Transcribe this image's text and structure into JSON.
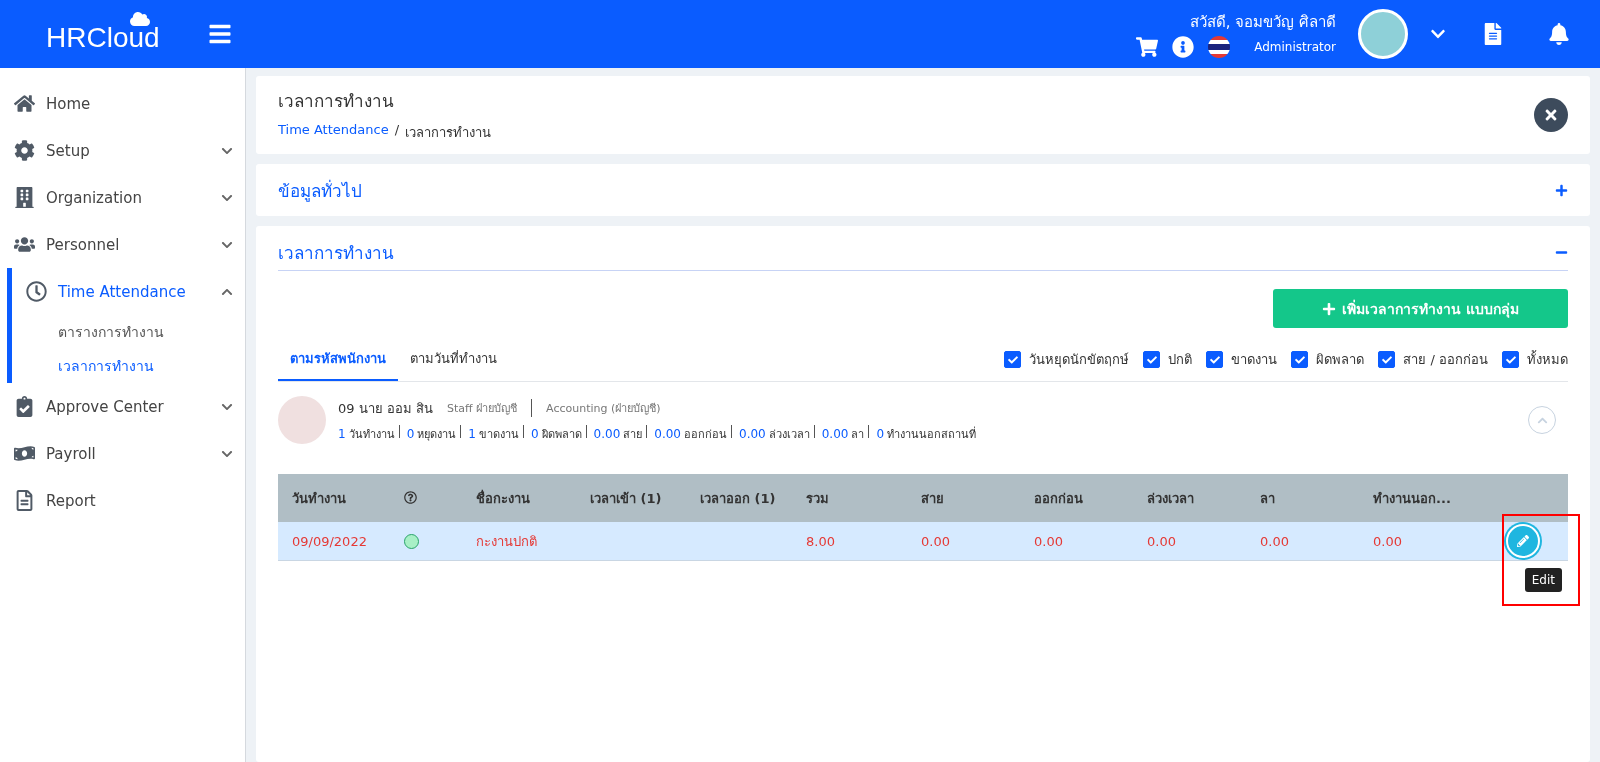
{
  "header": {
    "logo": "HRCloud",
    "greeting": "สวัสดี, จอมขวัญ ศิลาดี",
    "role": "Administrator"
  },
  "sidebar": {
    "items": [
      {
        "label": "Home",
        "kind": "link",
        "selected": false
      },
      {
        "label": "Setup",
        "kind": "menu",
        "selected": false,
        "expanded": false
      },
      {
        "label": "Organization",
        "kind": "menu",
        "selected": false,
        "expanded": false
      },
      {
        "label": "Personnel",
        "kind": "menu",
        "selected": false,
        "expanded": false
      },
      {
        "label": "Time Attendance",
        "kind": "menu",
        "selected": true,
        "expanded": true,
        "children": [
          {
            "label": "ตารางการทำงาน",
            "selected": false
          },
          {
            "label": "เวลาการทำงาน",
            "selected": true
          }
        ]
      },
      {
        "label": "Approve Center",
        "kind": "menu",
        "selected": false,
        "expanded": false
      },
      {
        "label": "Payroll",
        "kind": "menu",
        "selected": false,
        "expanded": false
      },
      {
        "label": "Report",
        "kind": "link",
        "selected": false
      }
    ]
  },
  "page": {
    "title": "เวลาการทำงาน",
    "breadcrumb": [
      {
        "label": "Time Attendance"
      },
      {
        "label": "เวลาการทำงาน"
      }
    ],
    "separator": "/"
  },
  "sections": [
    {
      "title": "ข้อมูลทั่วไป",
      "expanded": false
    },
    {
      "title": "เวลาการทำงาน",
      "expanded": true
    }
  ],
  "add_button": "เพิ่มเวลาการทำงาน แบบกลุ่ม",
  "tabs": [
    {
      "label": "ตามรหัสพนักงาน",
      "selected": true
    },
    {
      "label": "ตามวันที่ทำงาน",
      "selected": false
    }
  ],
  "filters": [
    {
      "label": "วันหยุดนักขัตฤกษ์",
      "checked": true
    },
    {
      "label": "ปกติ",
      "checked": true
    },
    {
      "label": "ขาดงาน",
      "checked": true
    },
    {
      "label": "ผิดพลาด",
      "checked": true
    },
    {
      "label": "สาย / ออกก่อน",
      "checked": true
    },
    {
      "label": "ทั้งหมด",
      "checked": true
    }
  ],
  "employee": {
    "name": "09 นาย ออม สิน",
    "position": "Staff ฝ่ายบัญชี",
    "department": "Accounting (ฝ่ายบัญชี)",
    "expanded": true,
    "stats": [
      {
        "count": "1",
        "unit": "วันทำงาน"
      },
      {
        "count": "0",
        "unit": "หยุดงาน"
      },
      {
        "count": "1",
        "unit": "ขาดงาน"
      },
      {
        "count": "0",
        "unit": "ผิดพลาด"
      },
      {
        "count": "0.00",
        "unit": "สาย"
      },
      {
        "count": "0.00",
        "unit": "ออกก่อน"
      },
      {
        "count": "0.00",
        "unit": "ล่วงเวลา"
      },
      {
        "count": "0.00",
        "unit": "ลา"
      },
      {
        "count": "0",
        "unit": "ทำงานนอกสถานที่"
      }
    ]
  },
  "table": {
    "columns": [
      "วันทำงาน",
      "ชื่อกะงาน",
      "เวลาเข้า (1)",
      "เวลาออก (1)",
      "รวม",
      "สาย",
      "ออกก่อน",
      "ล่วงเวลา",
      "ลา",
      "ทำงานนอก..."
    ],
    "rows": [
      {
        "selected": true,
        "cells": [
          "09/09/2022",
          "กะงานปกติ",
          "",
          "",
          "8.00",
          "0.00",
          "0.00",
          "0.00",
          "0.00",
          "0.00"
        ]
      }
    ]
  },
  "tooltip": "Edit"
}
